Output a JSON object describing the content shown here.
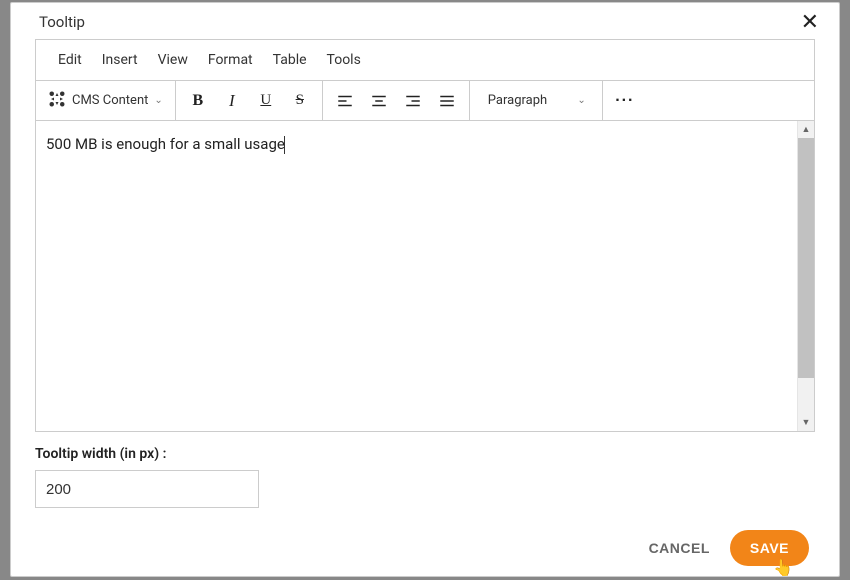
{
  "modal": {
    "title": "Tooltip",
    "close": "✕"
  },
  "menubar": {
    "edit": "Edit",
    "insert": "Insert",
    "view": "View",
    "format": "Format",
    "table": "Table",
    "tools": "Tools"
  },
  "toolbar": {
    "cms_content": "CMS Content",
    "format_selected": "Paragraph",
    "bold": "B",
    "italic": "I",
    "underline": "U",
    "strike": "S",
    "more": "···"
  },
  "editor": {
    "content": "500 MB is enough for a small usage"
  },
  "width_field": {
    "label": "Tooltip width (in px) :",
    "value": "200"
  },
  "footer": {
    "cancel": "CANCEL",
    "save": "SAVE"
  }
}
